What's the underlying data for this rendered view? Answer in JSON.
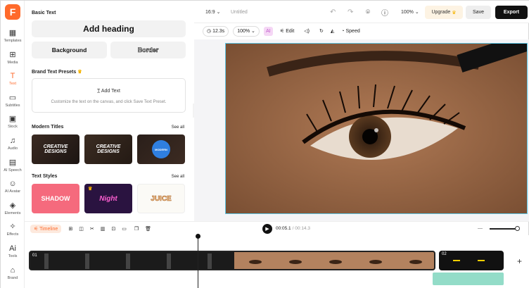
{
  "rail": {
    "items": [
      {
        "label": "Templates",
        "icon": "templates-icon"
      },
      {
        "label": "Media",
        "icon": "media-icon"
      },
      {
        "label": "Text",
        "icon": "text-icon"
      },
      {
        "label": "Subtitles",
        "icon": "subtitles-icon"
      },
      {
        "label": "Stock",
        "icon": "stock-icon"
      },
      {
        "label": "Audio",
        "icon": "audio-icon"
      },
      {
        "label": "AI Speech",
        "icon": "ai-speech-icon"
      },
      {
        "label": "AI Avatar",
        "icon": "ai-avatar-icon"
      },
      {
        "label": "Elements",
        "icon": "elements-icon"
      },
      {
        "label": "Effects",
        "icon": "effects-icon"
      },
      {
        "label": "Tools",
        "icon": "tools-icon"
      },
      {
        "label": "Brand",
        "icon": "brand-icon"
      }
    ],
    "active": "Text"
  },
  "panel": {
    "basic_text_title": "Basic Text",
    "add_heading": "Add heading",
    "background": "Background",
    "border": "Border",
    "brand_presets_title": "Brand Text Presets",
    "add_text": "Add Text",
    "hint": "Customize the text on the canvas, and click Save Text Preset.",
    "modern_titles": "Modern Titles",
    "see_all_1": "See all",
    "text_styles": "Text Styles",
    "see_all_2": "See all",
    "modern_thumbs": [
      "CREATIVE DESIGNS",
      "CREATIVE DESIGNS",
      "MODERN"
    ],
    "style_thumbs": [
      "SHADOW",
      "Night",
      "JUICE"
    ]
  },
  "topbar": {
    "ratio": "16:9",
    "title": "Untitled",
    "zoom": "100%",
    "upgrade": "Upgrade",
    "save": "Save",
    "export": "Export"
  },
  "toolbar": {
    "duration": "12.3s",
    "scale": "100%",
    "edit": "Edit",
    "speed": "Speed"
  },
  "timeline": {
    "label": "Timeline",
    "current": "00:05.1",
    "total": "/ 00:14.3",
    "clip1": "01",
    "clip2": "02"
  },
  "colors": {
    "accent": "#ff6a2b",
    "selection": "#5ec7e6",
    "export_bg": "#111111"
  }
}
